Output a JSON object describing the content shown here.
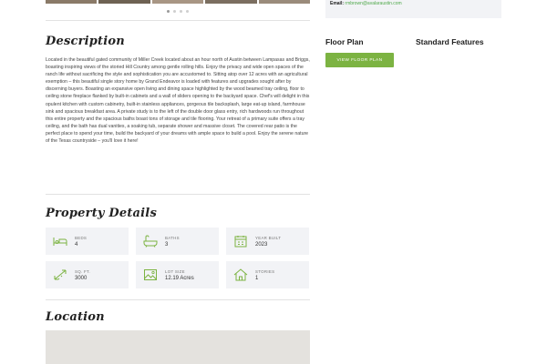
{
  "contact": {
    "email_label": "Email:",
    "email_value": "rmbrown@avalaraustin.com"
  },
  "description": {
    "heading": "Description",
    "text": "Located in the beautiful gated community of Miller Creek located about an hour north of Austin between Lampasas and Briggs, boasting inspiring views of the storied Hill Country among gentle rolling hills. Enjoy the privacy and wide open spaces of the ranch life without sacrificing the style and sophistication you are accustomed to. Sitting atop over 12 acres with an agricultural exemption – this beautiful single story home by Grand Endeavor is loaded with features and upgrades sought after by discerning buyers. Boasting an expansive open living and dining space highlighted by the wood beamed tray ceiling, floor to ceiling stone fireplace flanked by built-in cabinets and a wall of sliders opening to the backyard space. Chef's will delight in this opulent kitchen with custom cabinetry, built-in stainless appliances, gorgeous tile backsplash, large eat-up island, farmhouse sink and spacious breakfast area. A private study is to the left of the double door glass entry, rich hardwoods run throughout this entire property and the spacious baths boast tons of storage and tile flooring. Your retreat of a primary suite offers a tray ceiling, and the bath has dual vanities, a soaking tub, separate shower and massive closet. The covered rear patio is the perfect place to spend your time, build the backyard of your dreams with ample space to build a pool. Enjoy the serene nature of the Texas countryside – you'll love it here!"
  },
  "details": {
    "heading": "Property Details",
    "items": [
      {
        "label": "BEDS",
        "value": "4",
        "icon": "bed-icon"
      },
      {
        "label": "BATHS",
        "value": "3",
        "icon": "bathtub-icon"
      },
      {
        "label": "YEAR BUILT",
        "value": "2023",
        "icon": "calendar-icon"
      },
      {
        "label": "SQ. FT.",
        "value": "3000",
        "icon": "area-icon"
      },
      {
        "label": "LOT SIZE",
        "value": "12.19 Acres",
        "icon": "landscape-icon"
      },
      {
        "label": "STORIES",
        "value": "1",
        "icon": "house-icon"
      }
    ]
  },
  "location": {
    "heading": "Location"
  },
  "sidebar": {
    "floor_plan_heading": "Floor Plan",
    "floor_plan_button": "VIEW FLOOR PLAN",
    "features_heading": "Standard Features"
  },
  "colors": {
    "accent": "#7cb342",
    "card_bg": "#f2f3f6",
    "icon": "#7cb342"
  }
}
